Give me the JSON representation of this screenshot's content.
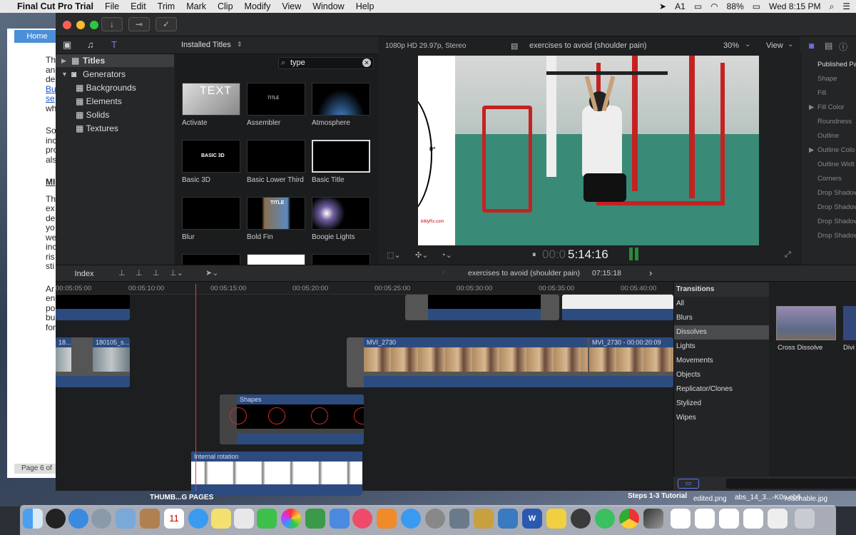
{
  "menubar": {
    "apple": "",
    "app_name": "Final Cut Pro Trial",
    "menus": [
      "File",
      "Edit",
      "Trim",
      "Mark",
      "Clip",
      "Modify",
      "View",
      "Window",
      "Help"
    ],
    "right": {
      "adobe": "1",
      "battery": "88%",
      "clock": "Wed 8:15 PM"
    }
  },
  "background_doc": {
    "home_label": "Home",
    "text_lines": [
      "Th",
      "an",
      "de",
      "Bu",
      "se",
      "wh",
      "So",
      "inc",
      "pro",
      "als",
      "MI",
      "Th",
      "ex",
      "de",
      "yo",
      "we",
      "inc",
      "ris",
      "sti",
      "Ar",
      "en",
      "po",
      "bu",
      "for"
    ],
    "page_indicator": "Page 6 of",
    "desktop_labels": [
      "THUMB...G PAGES",
      "Steps 1-3 Tutorial",
      "edited.png",
      "abs_14_3...-K0n.eb6",
      "reachable.jpg"
    ]
  },
  "browser": {
    "dropdown_label": "Installed Titles",
    "search_value": "type",
    "sidebar": [
      {
        "label": "Titles",
        "selected": true
      },
      {
        "label": "Generators",
        "selected": false
      },
      {
        "label": "Backgrounds"
      },
      {
        "label": "Elements"
      },
      {
        "label": "Solids"
      },
      {
        "label": "Textures"
      }
    ],
    "titles": [
      "Activate",
      "Assembler",
      "Atmosphere",
      "Basic 3D",
      "Basic Lower Third",
      "Basic Title",
      "Blur",
      "Bold Fin",
      "Boogie Lights"
    ],
    "thumb_texts": {
      "activate": "TEXT",
      "assembler": "TITLE",
      "basic3d": "BASIC 3D",
      "boldfin": "TITLE"
    }
  },
  "viewer": {
    "format": "1080p HD 29.97p, Stereo",
    "project_name": "exercises to avoid (shoulder pain)",
    "zoom": "30%",
    "view_label": "View",
    "timecode_dim": "00:0",
    "timecode": "5:14:16",
    "overlay_angle": "0°",
    "overlay_url": "bilityRx.com"
  },
  "inspector": {
    "header": "Published Pa",
    "rows": [
      "Shape",
      "Fill",
      "Fill Color",
      "Roundness",
      "Outline",
      "Outline Colo",
      "Outline Widt",
      "Corners",
      "Drop Shadow",
      "Drop Shadow",
      "Drop Shadow",
      "Drop Shadow"
    ]
  },
  "timeline": {
    "index_label": "Index",
    "project_name": "exercises to avoid (shoulder pain)",
    "duration": "07:15:18",
    "ruler": [
      "00:05:05:00",
      "00:05:10:00",
      "00:05:15:00",
      "00:05:20:00",
      "00:05:25:00",
      "00:05:30:00",
      "00:05:35:00",
      "00:05:40:00"
    ],
    "clips": {
      "left_a": "18...",
      "left_b": "180105_s...",
      "mvi": "MVI_2730",
      "mvi2": "MVI_2730 - 00:00:20:09",
      "shapes": "Shapes",
      "rotation": "Internal rotation"
    }
  },
  "transitions": {
    "header": "Transitions",
    "categories": [
      "All",
      "Blurs",
      "Dissolves",
      "Lights",
      "Movements",
      "Objects",
      "Replicator/Clones",
      "Stylized",
      "Wipes"
    ],
    "selected": "Dissolves",
    "preview_items": [
      "Cross Dissolve",
      "Divi"
    ]
  },
  "colors": {
    "accent": "#2c4c80",
    "playhead": "#e04040",
    "selection": "#3d3e41"
  }
}
